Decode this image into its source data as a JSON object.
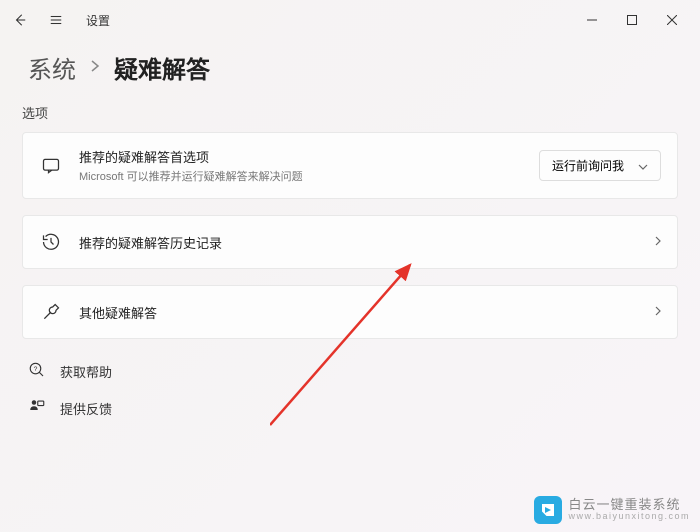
{
  "titlebar": {
    "app_title": "设置"
  },
  "breadcrumb": {
    "parent": "系统",
    "current": "疑难解答"
  },
  "section_label": "选项",
  "cards": {
    "recommended": {
      "title": "推荐的疑难解答首选项",
      "subtitle": "Microsoft 可以推荐并运行疑难解答来解决问题",
      "dropdown_label": "运行前询问我"
    },
    "history": {
      "title": "推荐的疑难解答历史记录"
    },
    "other": {
      "title": "其他疑难解答"
    }
  },
  "help": {
    "get_help": "获取帮助",
    "feedback": "提供反馈"
  },
  "watermark": {
    "top": "白云一键重装系统",
    "bottom": "www.baiyunxitong.com"
  }
}
